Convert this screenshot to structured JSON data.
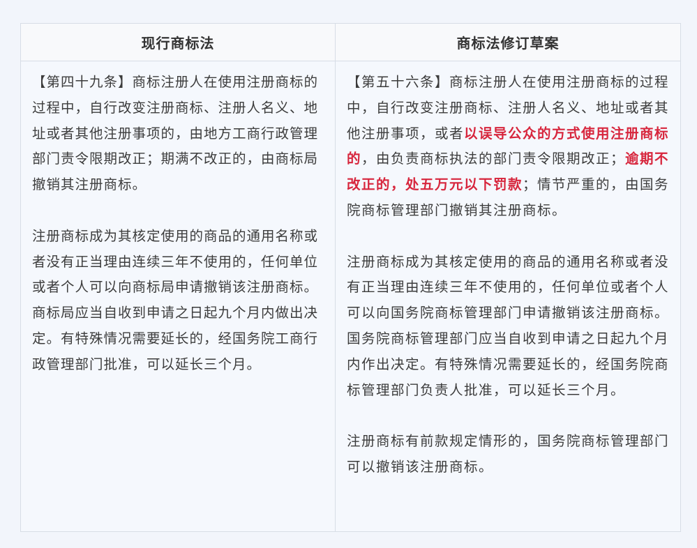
{
  "table": {
    "headers": [
      "现行商标法",
      "商标法修订草案"
    ],
    "left_column": {
      "paragraphs": [
        "【第四十九条】商标注册人在使用注册商标的过程中，自行改变注册商标、注册人名义、地址或者其他注册事项的，由地方工商行政管理部门责令限期改正；期满不改正的，由商标局撤销其注册商标。",
        "注册商标成为其核定使用的商品的通用名称或者没有正当理由连续三年不使用的，任何单位或者个人可以向商标局申请撤销该注册商标。商标局应当自收到申请之日起九个月内做出决定。有特殊情况需要延长的，经国务院工商行政管理部门批准，可以延长三个月。"
      ]
    },
    "right_column": {
      "paragraph1": {
        "part1": "【第五十六条】商标注册人在使用注册商标的过程中，自行改变注册商标、注册人名义、地址或者其他注册事项，或者",
        "highlight1": "以误导公众的方式使用注册商标的",
        "part2": "，由负责商标执法的部门责令限期改正；",
        "highlight2": "逾期不改正的，处五万元以下罚款",
        "part3": "；情节严重的，由国务院商标管理部门撤销其注册商标。"
      },
      "paragraph2": "注册商标成为其核定使用的商品的通用名称或者没有正当理由连续三年不使用的，任何单位或者个人可以向国务院商标管理部门申请撤销该注册商标。国务院商标管理部门应当自收到申请之日起九个月内作出决定。有特殊情况需要延长的，经国务院商标管理部门负责人批准，可以延长三个月。",
      "paragraph3": "注册商标有前款规定情形的，国务院商标管理部门可以撤销该注册商标。"
    },
    "highlight_color": "#d7263d"
  }
}
